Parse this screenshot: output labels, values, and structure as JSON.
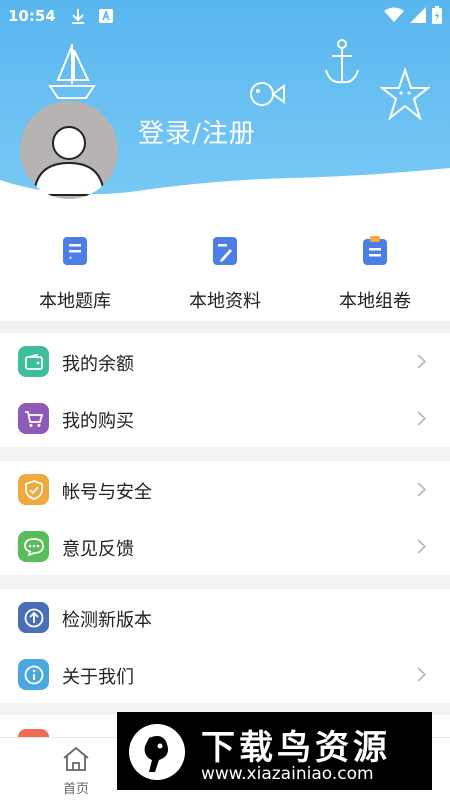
{
  "status": {
    "time": "10:54",
    "left_icons": [
      "download-icon",
      "a-box-icon"
    ],
    "right_icons": [
      "wifi-icon",
      "signal-icon",
      "battery-icon"
    ]
  },
  "profile": {
    "login_label": "登录/注册",
    "avatar": "default-avatar-icon"
  },
  "quick_actions": [
    {
      "label": "本地题库",
      "icon": "question-bank-icon"
    },
    {
      "label": "本地资料",
      "icon": "materials-icon"
    },
    {
      "label": "本地组卷",
      "icon": "clipboard-icon"
    }
  ],
  "groups": [
    {
      "items": [
        {
          "label": "我的余额",
          "icon": "wallet-icon",
          "color": "#3dbf9c"
        },
        {
          "label": "我的购买",
          "icon": "cart-icon",
          "color": "#8e5bb9"
        }
      ]
    },
    {
      "items": [
        {
          "label": "帐号与安全",
          "icon": "shield-icon",
          "color": "#f1a93b"
        },
        {
          "label": "意见反馈",
          "icon": "chat-icon",
          "color": "#59bd5b"
        }
      ]
    },
    {
      "items": [
        {
          "label": "检测新版本",
          "icon": "upload-arrow-icon",
          "color": "#4a6fb8"
        },
        {
          "label": "关于我们",
          "icon": "info-icon",
          "color": "#4aa7e0"
        }
      ]
    }
  ],
  "bottom_nav": {
    "home_label": "首页"
  },
  "watermark": {
    "title": "下载鸟资源",
    "url": "www.xiazainiao.com"
  },
  "colors": {
    "header_top": "#58b6ee",
    "header_bottom": "#7ccaf5",
    "quick_icon": "#4c7ee8"
  }
}
